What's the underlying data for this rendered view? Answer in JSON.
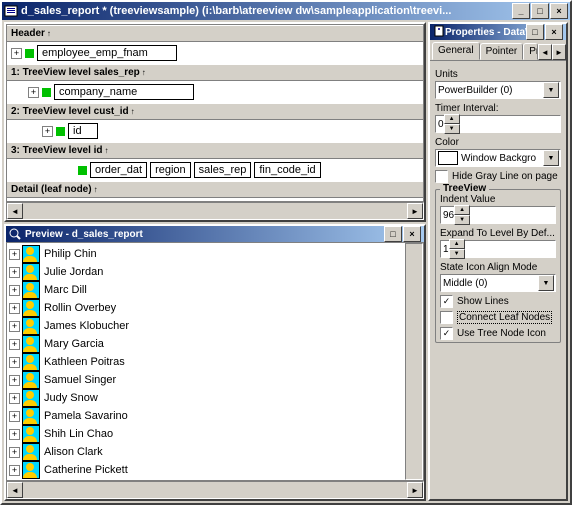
{
  "window": {
    "title": "d_sales_report * (treeviewsample) (i:\\barb\\atreeview dw\\sampleapplication\\treevi..."
  },
  "design": {
    "bands": {
      "header": "Header",
      "level1": "1: TreeView level sales_rep",
      "level2": "2: TreeView level cust_id",
      "level3": "3: TreeView level id",
      "detail": "Detail (leaf node)"
    },
    "fields": {
      "header_field": "employee_emp_fnam",
      "level1_field": "company_name",
      "level2_field": "id",
      "level3_fields": [
        "order_dat",
        "region",
        "sales_rep",
        "fin_code_id"
      ]
    }
  },
  "preview": {
    "title": "Preview - d_sales_report",
    "rows": [
      "Philip  Chin",
      "Julie  Jordan",
      "Marc  Dill",
      "Rollin  Overbey",
      "James  Klobucher",
      "Mary  Garcia",
      "Kathleen  Poitras",
      "Samuel  Singer",
      "Judy  Snow",
      "Pamela  Savarino",
      "Shih Lin  Chao",
      "Alison  Clark",
      "Catherine  Pickett"
    ]
  },
  "properties": {
    "title": "Properties - DataW",
    "tabs": {
      "general": "General",
      "pointer": "Pointer",
      "print": "Pri"
    },
    "units_label": "Units",
    "units_value": "PowerBuilder (0)",
    "timer_label": "Timer Interval:",
    "timer_value": "0",
    "color_label": "Color",
    "color_value": "Window Backgro",
    "hide_gray": "Hide Gray Line on page",
    "treeview_section": "TreeView",
    "indent_label": "Indent Value",
    "indent_value": "96",
    "expand_label": "Expand To Level By Def...",
    "expand_value": "1",
    "state_label": "State Icon Align Mode",
    "state_value": "Middle (0)",
    "show_lines": "Show Lines",
    "connect_leaf": "Connect Leaf Nodes",
    "use_tree_icon": "Use Tree Node Icon"
  }
}
